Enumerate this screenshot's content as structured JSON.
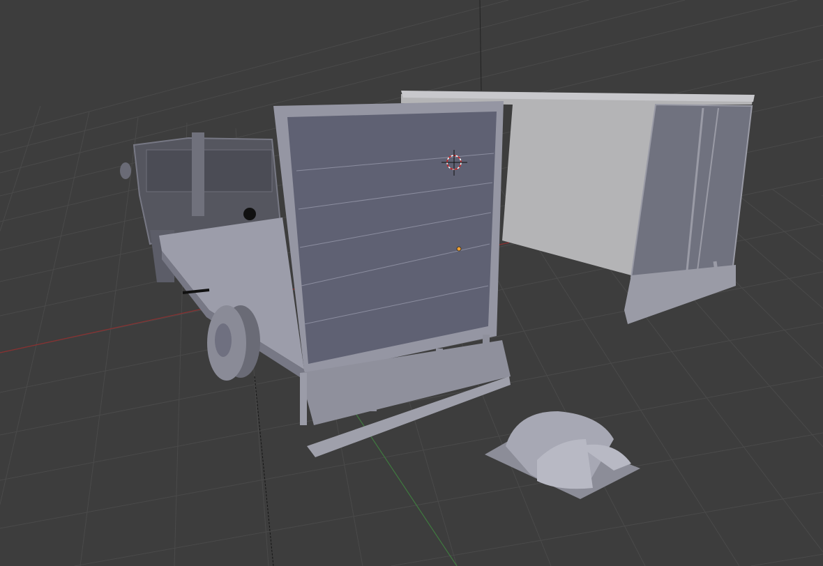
{
  "viewport": {
    "background": "#3d3d3d",
    "grid_color": "#4a4a4a",
    "x_axis_color": "#8a3030",
    "y_axis_color": "#3f7a3f",
    "mesh_color": "#6a6c7c",
    "mesh_light": "#a9aab4",
    "box_wall": "#b4b4b6",
    "cursor_icon": "3d-cursor-icon",
    "origin_icon": "object-origin-icon",
    "origin_color": "#f0a030"
  }
}
